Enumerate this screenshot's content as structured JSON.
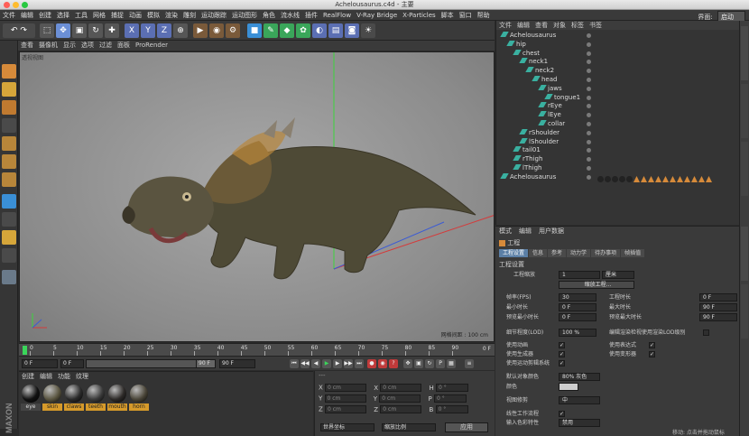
{
  "window": {
    "title": "Achelousaurus.c4d - 主要"
  },
  "menubar": {
    "items": [
      "文件",
      "编辑",
      "创建",
      "选择",
      "工具",
      "网格",
      "捕捉",
      "动画",
      "模拟",
      "渲染",
      "雕刻",
      "运动跟踪",
      "运动图形",
      "角色",
      "流水线",
      "插件",
      "RealFlow",
      "V-Ray Bridge",
      "X-Particles",
      "脚本",
      "窗口",
      "帮助"
    ],
    "interface_label": "界面:",
    "interface_value": "启动"
  },
  "viewport": {
    "menu": [
      "查看",
      "摄像机",
      "显示",
      "选项",
      "过滤",
      "面板",
      "ProRender"
    ],
    "label": "透视视图",
    "grid_spacing": "网格间距 : 100 cm",
    "colors": {
      "axis_x": "#d43b3b",
      "axis_y": "#3bd43b",
      "axis_z": "#3b5bd4"
    }
  },
  "timeline": {
    "ticks": [
      "0",
      "5",
      "10",
      "15",
      "20",
      "25",
      "30",
      "35",
      "40",
      "45",
      "50",
      "55",
      "60",
      "65",
      "70",
      "75",
      "80",
      "85",
      "90"
    ],
    "end_label": "0 F"
  },
  "playback": {
    "current": "0 F",
    "start": "0 F",
    "end": "90 F",
    "end2": "90 F"
  },
  "materials": {
    "menu": [
      "创建",
      "编辑",
      "功能",
      "纹理"
    ],
    "items": [
      {
        "name": "eye",
        "color": "#111111"
      },
      {
        "name": "skin",
        "color": "#5a5540"
      },
      {
        "name": "claws",
        "color": "#2a2a2a"
      },
      {
        "name": "teeth",
        "color": "#3a3a3a"
      },
      {
        "name": "mouth",
        "color": "#2d2a28"
      },
      {
        "name": "horn",
        "color": "#4a4538"
      }
    ]
  },
  "coords": {
    "header_left": "",
    "header_mid": "",
    "rows": [
      {
        "a": "X",
        "av": "0 cm",
        "b": "X",
        "bv": "0 cm",
        "c": "H",
        "cv": "0 °"
      },
      {
        "a": "Y",
        "av": "0 cm",
        "b": "Y",
        "bv": "0 cm",
        "c": "P",
        "cv": "0 °"
      },
      {
        "a": "Z",
        "av": "0 cm",
        "b": "Z",
        "bv": "0 cm",
        "c": "B",
        "cv": "0 °"
      }
    ],
    "space": "世界坐标",
    "scale": "缩放比例",
    "apply": "应用"
  },
  "objects": {
    "menu": [
      "文件",
      "编辑",
      "查看",
      "对象",
      "标签",
      "书签"
    ],
    "tree": [
      {
        "label": "Achelousaurus",
        "depth": 0
      },
      {
        "label": "hip",
        "depth": 1
      },
      {
        "label": "chest",
        "depth": 2
      },
      {
        "label": "neck1",
        "depth": 3
      },
      {
        "label": "neck2",
        "depth": 4
      },
      {
        "label": "head",
        "depth": 5
      },
      {
        "label": "jaws",
        "depth": 6
      },
      {
        "label": "tongue1",
        "depth": 7
      },
      {
        "label": "rEye",
        "depth": 6
      },
      {
        "label": "lEye",
        "depth": 6
      },
      {
        "label": "collar",
        "depth": 6
      },
      {
        "label": "rShoulder",
        "depth": 3
      },
      {
        "label": "lShoulder",
        "depth": 3
      },
      {
        "label": "tail01",
        "depth": 2
      },
      {
        "label": "rThigh",
        "depth": 2
      },
      {
        "label": "lThigh",
        "depth": 2
      },
      {
        "label": "Achelousaurus",
        "depth": 0
      }
    ]
  },
  "attributes": {
    "menu": [
      "模式",
      "编辑",
      "用户数据"
    ],
    "object_title": "工程",
    "tabs": [
      "工程设置",
      "信息",
      "参考",
      "动力学",
      "待办事项",
      "帧插值"
    ],
    "section": "工程设置",
    "project_scale_label": "工程缩放",
    "project_scale_value": "1",
    "project_scale_unit": "厘米",
    "scale_button": "缩放工程...",
    "fps_label": "帧率(FPS)",
    "fps_value": "30",
    "project_time_label": "工程时长",
    "project_time_value": "0 F",
    "min_time_label": "最小时长",
    "min_time_value": "0 F",
    "max_time_label": "最大时长",
    "max_time_value": "90 F",
    "prev_min_label": "预览最小时长",
    "prev_min_value": "0 F",
    "prev_max_label": "预览最大时长",
    "prev_max_value": "90 F",
    "lod_label": "细节程度(LOD)",
    "lod_value": "100 %",
    "lod_render_label": "编辑渲染检视使用渲染LOD级别",
    "use_anim": "使用动画",
    "use_expr": "使用表达式",
    "use_gen": "使用生成器",
    "use_deform": "使用变形器",
    "use_motion": "使用运动剪辑系统",
    "default_color_label": "默认对象颜色",
    "default_color_value": "80% 灰色",
    "color_label": "颜色",
    "view_clip_label": "视图修剪",
    "view_clip_value": "中",
    "linear_label": "线性工作流程",
    "input_color_label": "输入色彩特性",
    "input_color_value": "禁用"
  },
  "status": {
    "text": "移动: 点击并拖动鼠标"
  }
}
